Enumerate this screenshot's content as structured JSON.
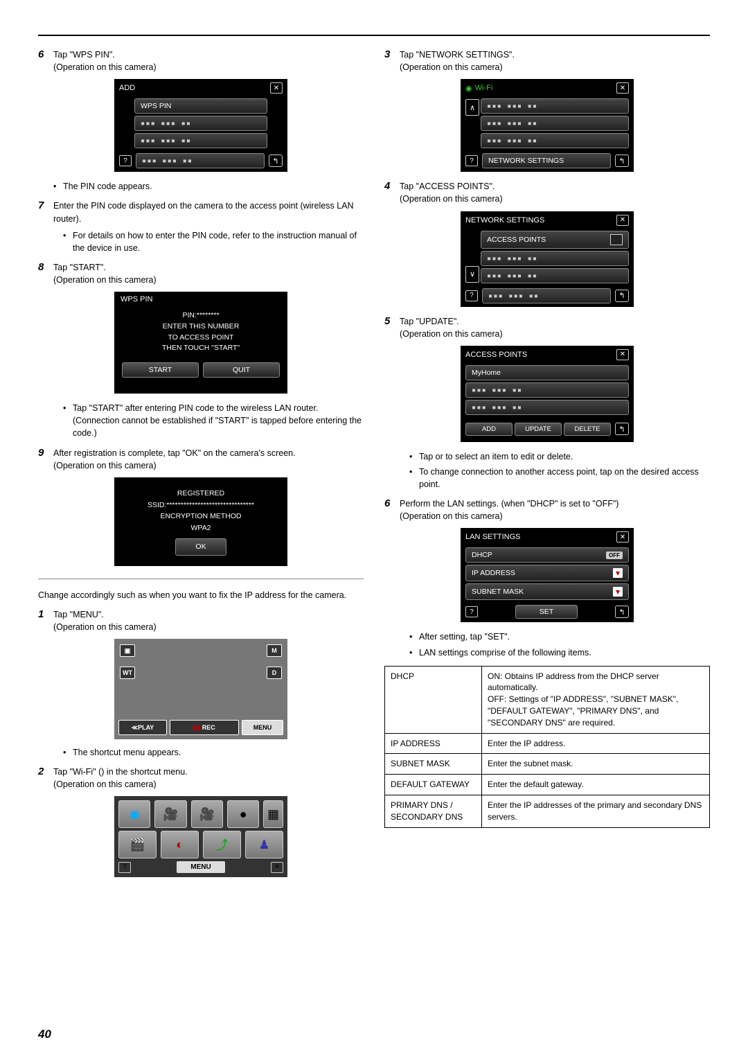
{
  "page_number": "40",
  "left": {
    "step6": {
      "num": "6",
      "text": "Tap \"WPS PIN\".",
      "sub": "(Operation on this camera)"
    },
    "screen_add": {
      "title": "ADD",
      "row1": "WPS PIN"
    },
    "bullet_pin": "The PIN code appears.",
    "step7": {
      "num": "7",
      "text": "Enter the PIN code displayed on the camera to the access point (wireless LAN router)."
    },
    "bullet7": "For details on how to enter the PIN code, refer to the instruction manual of the device in use.",
    "step8": {
      "num": "8",
      "text": "Tap \"START\".",
      "sub": "(Operation on this camera)"
    },
    "screen_wps": {
      "title": "WPS PIN",
      "pin": "PIN:********",
      "l1": "ENTER THIS NUMBER",
      "l2": "TO ACCESS POINT",
      "l3": "THEN TOUCH \"START\"",
      "start": "START",
      "quit": "QUIT"
    },
    "bullet8": "Tap \"START\" after entering PIN code to the wireless LAN router. (Connection cannot be established if \"START\" is tapped before entering the code.)",
    "step9": {
      "num": "9",
      "text": "After registration is complete, tap \"OK\" on the camera's screen.",
      "sub": "(Operation on this camera)"
    },
    "screen_reg": {
      "l1": "REGISTERED",
      "l2": "SSID:*******************************",
      "l3": "ENCRYPTION METHOD",
      "l4": "WPA2",
      "ok": "OK"
    },
    "intro2": "Change accordingly such as when you want to fix the IP address for the camera.",
    "step1": {
      "num": "1",
      "text": "Tap \"MENU\".",
      "sub": "(Operation on this camera)"
    },
    "menu_screen": {
      "play": "≪PLAY",
      "rec": "REC",
      "menu": "MENU",
      "wt": "WT",
      "m": "M",
      "d": "D"
    },
    "bullet1": "The shortcut menu appears.",
    "step2": {
      "num": "2",
      "text": "Tap \"Wi-Fi\" () in the shortcut menu.",
      "sub": "(Operation on this camera)"
    },
    "shortcut": {
      "menu": "MENU"
    }
  },
  "right": {
    "step3": {
      "num": "3",
      "text": "Tap \"NETWORK SETTINGS\".",
      "sub": "(Operation on this camera)"
    },
    "screen_wifi": {
      "title": "Wi-Fi",
      "row4": "NETWORK SETTINGS"
    },
    "step4": {
      "num": "4",
      "text": "Tap \"ACCESS POINTS\".",
      "sub": "(Operation on this camera)"
    },
    "screen_net": {
      "title": "NETWORK SETTINGS",
      "row1": "ACCESS POINTS"
    },
    "step5": {
      "num": "5",
      "text": "Tap \"UPDATE\".",
      "sub": "(Operation on this camera)"
    },
    "screen_ap": {
      "title": "ACCESS POINTS",
      "row1": "MyHome",
      "add": "ADD",
      "update": "UPDATE",
      "delete": "DELETE"
    },
    "bullet5a": "Tap  or  to select an item to edit or delete.",
    "bullet5b": "To change connection to another access point, tap on the desired access point.",
    "step6": {
      "num": "6",
      "text": "Perform the LAN settings. (when \"DHCP\" is set to \"OFF\")",
      "sub": "(Operation on this camera)"
    },
    "screen_lan": {
      "title": "LAN SETTINGS",
      "dhcp": "DHCP",
      "off": "OFF",
      "ip": "IP ADDRESS",
      "mask": "SUBNET MASK",
      "set": "SET"
    },
    "bullet6a": "After setting, tap \"SET\".",
    "bullet6b": "LAN settings comprise of the following items.",
    "table": {
      "r1a": "DHCP",
      "r1b": "ON: Obtains IP address from the DHCP server automatically.\nOFF: Settings of \"IP ADDRESS\", \"SUBNET MASK\", \"DEFAULT GATEWAY\", \"PRIMARY DNS\", and \"SECONDARY DNS\" are required.",
      "r2a": "IP ADDRESS",
      "r2b": "Enter the IP address.",
      "r3a": "SUBNET MASK",
      "r3b": "Enter the subnet mask.",
      "r4a": "DEFAULT GATEWAY",
      "r4b": "Enter the default gateway.",
      "r5a": "PRIMARY DNS / SECONDARY DNS",
      "r5b": "Enter the IP addresses of the primary and secondary DNS servers."
    }
  }
}
